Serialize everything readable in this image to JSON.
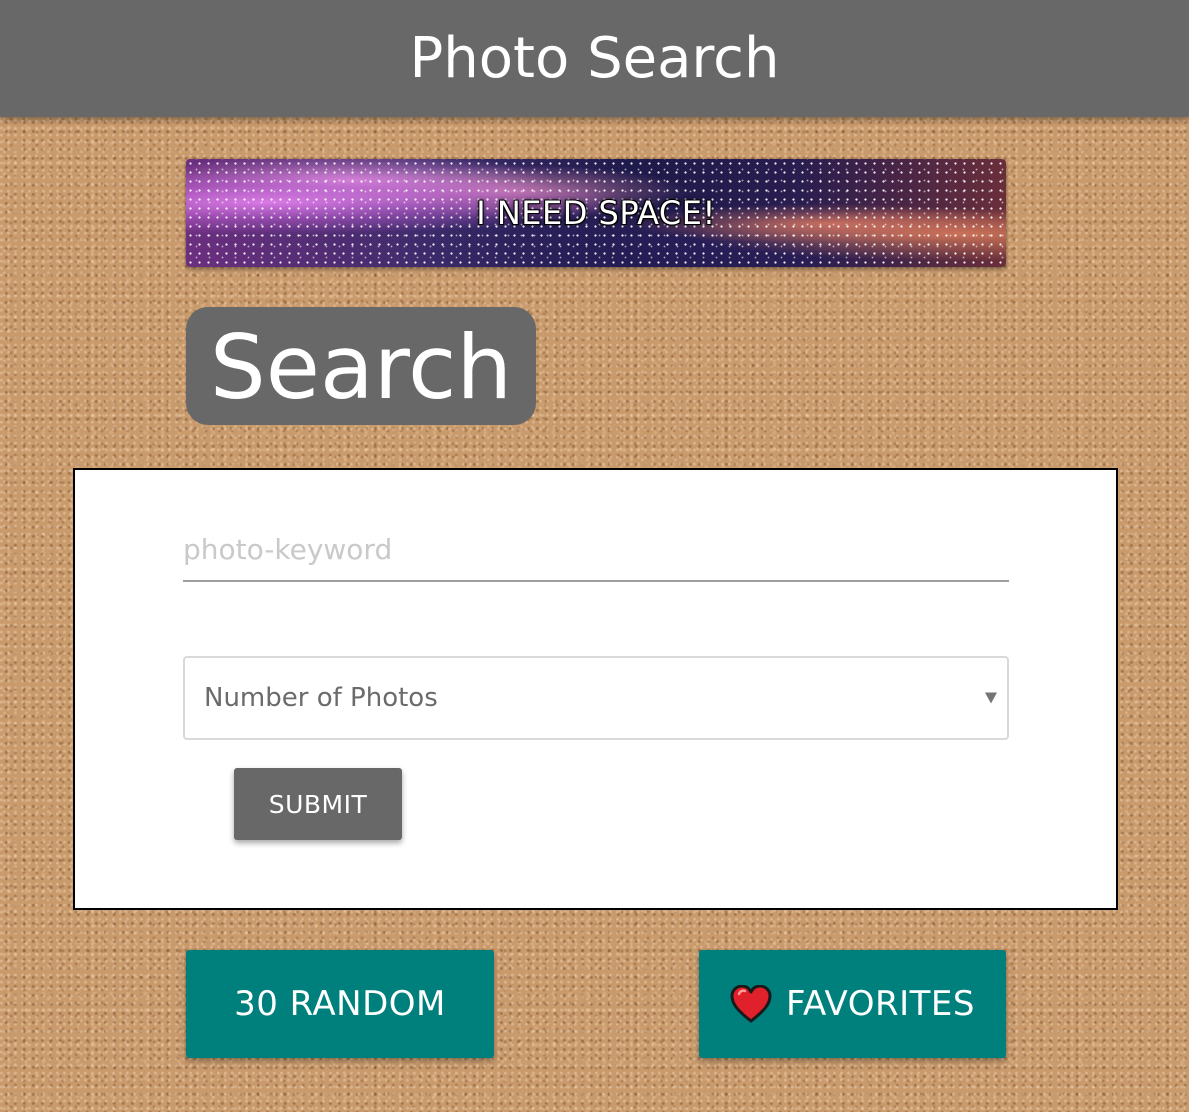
{
  "header": {
    "title": "Photo Search"
  },
  "banner": {
    "label": "I NEED SPACE!"
  },
  "search_section": {
    "heading": "Search",
    "keyword_placeholder": "photo-keyword",
    "keyword_value": "",
    "count_select_label": "Number of Photos",
    "submit_label": "SUBMIT"
  },
  "actions": {
    "random_label": "30 RANDOM",
    "favorites_label": "FAVORITES",
    "favorites_icon": "heart-icon"
  },
  "colors": {
    "header_bg": "#686868",
    "action_button_bg": "#00807d",
    "heart": "#e0202a"
  }
}
